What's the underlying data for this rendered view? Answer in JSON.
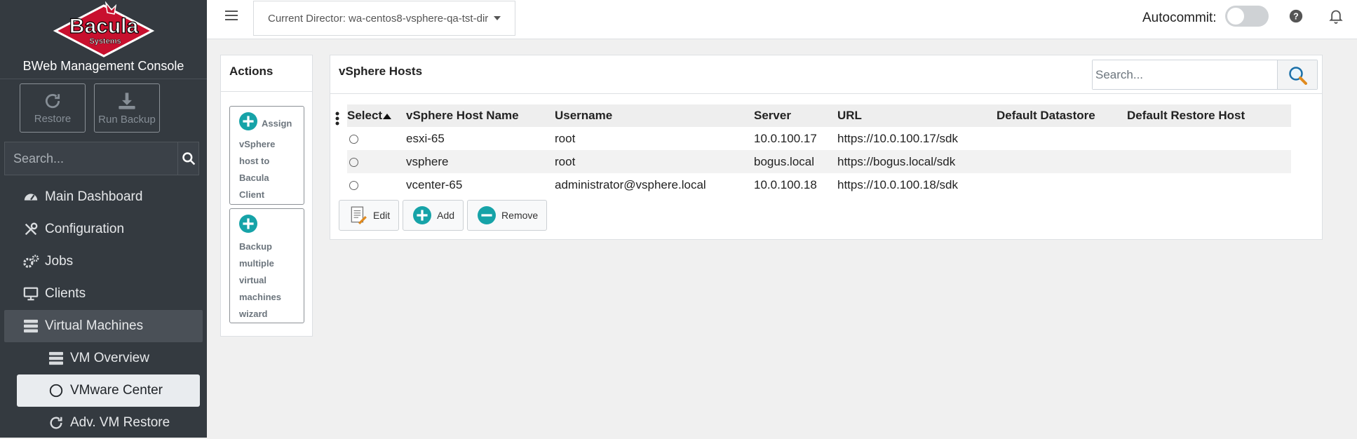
{
  "brand": {
    "logo_text": "Bacula",
    "logo_subtext": "Systems",
    "console_title": "BWeb Management Console",
    "accent_color": "#16a3a8"
  },
  "sidebar": {
    "restore_label": "Restore",
    "run_backup_label": "Run Backup",
    "search_placeholder": "Search...",
    "items": [
      {
        "label": "Main Dashboard",
        "icon": "gauge-icon"
      },
      {
        "label": "Configuration",
        "icon": "tools-icon"
      },
      {
        "label": "Jobs",
        "icon": "gears-icon"
      },
      {
        "label": "Clients",
        "icon": "desktop-icon"
      },
      {
        "label": "Virtual Machines",
        "icon": "server-icon",
        "state": "expanded"
      },
      {
        "label": "VM Overview",
        "icon": "server-icon"
      },
      {
        "label": "VMware Center",
        "icon": "circle-icon",
        "state": "selected"
      },
      {
        "label": "Adv. VM Restore",
        "icon": "refresh-icon"
      }
    ]
  },
  "topbar": {
    "director": "Current Director: wa-centos8-vsphere-qa-tst-dir",
    "autocommit_label": "Autocommit:",
    "autocommit_on": false
  },
  "actions": {
    "title": "Actions",
    "assign": [
      "Assign",
      "vSphere",
      "host to",
      "Bacula",
      "Client"
    ],
    "backup": [
      "Backup",
      "multiple",
      "virtual",
      "machines",
      "wizard"
    ]
  },
  "hosts": {
    "title": "vSphere Hosts",
    "search_placeholder": "Search...",
    "columns": [
      "Select",
      "vSphere Host Name",
      "Username",
      "Server",
      "URL",
      "Default Datastore",
      "Default Restore Host"
    ],
    "rows": [
      {
        "name": "esxi-65",
        "username": "root",
        "server": "10.0.100.17",
        "url": "https://10.0.100.17/sdk",
        "datastore": "",
        "restore_host": ""
      },
      {
        "name": "vsphere",
        "username": "root",
        "server": "bogus.local",
        "url": "https://bogus.local/sdk",
        "datastore": "",
        "restore_host": ""
      },
      {
        "name": "vcenter-65",
        "username": "administrator@vsphere.local",
        "server": "10.0.100.18",
        "url": "https://10.0.100.18/sdk",
        "datastore": "",
        "restore_host": ""
      }
    ],
    "edit_label": "Edit",
    "add_label": "Add",
    "remove_label": "Remove"
  }
}
